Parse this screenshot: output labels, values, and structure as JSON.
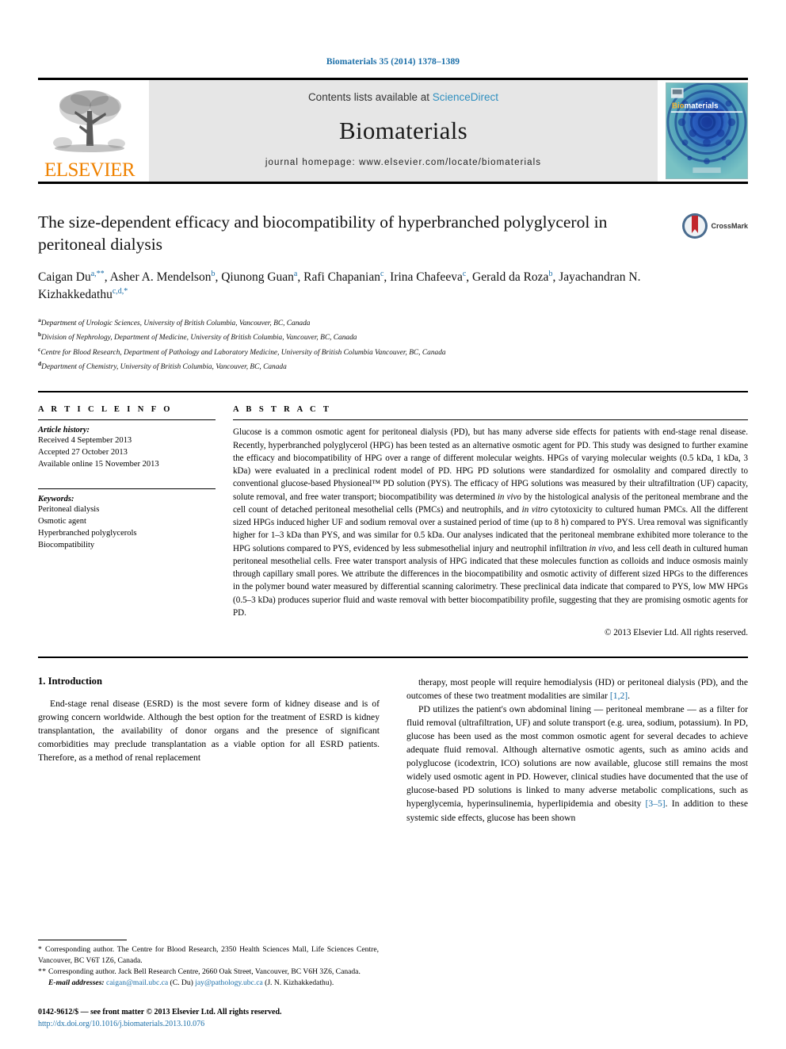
{
  "running_head": "Biomaterials 35 (2014) 1378–1389",
  "masthead": {
    "publisher": "ELSEVIER",
    "contents_prefix": "Contents lists available at ",
    "contents_link": "ScienceDirect",
    "journal_name": "Biomaterials",
    "homepage": "journal homepage: www.elsevier.com/locate/biomaterials",
    "cover_title_a": "Bio",
    "cover_title_b": "materials",
    "link_color": "#2f8fbf",
    "accent_color": "#1a6ea8",
    "elsevier_orange": "#ef8200"
  },
  "article": {
    "title": "The size-dependent efficacy and biocompatibility of hyperbranched polyglycerol in peritoneal dialysis",
    "crossmark_label": "CrossMark",
    "authors_line_1": "Caigan Du",
    "authors_line_2": "Gerald da Roza",
    "authors_html": "Caigan Du<sup>a,**</sup>, Asher A. Mendelson<sup>b</sup>, Qiunong Guan<sup>a</sup>, Rafi Chapanian<sup>c</sup>, Irina Chafeeva<sup>c</sup>, Gerald da Roza<sup>b</sup>, Jayachandran N. Kizhakkedathu<sup>c,d,*</sup>",
    "affiliations": [
      {
        "marker": "a",
        "text": "Department of Urologic Sciences, University of British Columbia, Vancouver, BC, Canada"
      },
      {
        "marker": "b",
        "text": "Division of Nephrology, Department of Medicine, University of British Columbia, Vancouver, BC, Canada"
      },
      {
        "marker": "c",
        "text": "Centre for Blood Research, Department of Pathology and Laboratory Medicine, University of British Columbia Vancouver, BC, Canada"
      },
      {
        "marker": "d",
        "text": "Department of Chemistry, University of British Columbia, Vancouver, BC, Canada"
      }
    ]
  },
  "article_info": {
    "heading": "A R T I C L E   I N F O",
    "history_label": "Article history:",
    "history": [
      "Received 4 September 2013",
      "Accepted 27 October 2013",
      "Available online 15 November 2013"
    ],
    "keywords_label": "Keywords:",
    "keywords": [
      "Peritoneal dialysis",
      "Osmotic agent",
      "Hyperbranched polyglycerols",
      "Biocompatibility"
    ]
  },
  "abstract": {
    "heading": "A B S T R A C T",
    "body_html": "Glucose is a common osmotic agent for peritoneal dialysis (PD), but has many adverse side effects for patients with end-stage renal disease. Recently, hyperbranched polyglycerol (HPG) has been tested as an alternative osmotic agent for PD. This study was designed to further examine the efficacy and biocompatibility of HPG over a range of different molecular weights. HPGs of varying molecular weights (0.5 kDa, 1 kDa, 3 kDa) were evaluated in a preclinical rodent model of PD. HPG PD solutions were standardized for osmolality and compared directly to conventional glucose-based Physioneal™ PD solution (PYS). The efficacy of HPG solutions was measured by their ultrafiltration (UF) capacity, solute removal, and free water transport; biocompatibility was determined <i>in vivo</i> by the histological analysis of the peritoneal membrane and the cell count of detached peritoneal mesothelial cells (PMCs) and neutrophils, and <i>in vitro</i> cytotoxicity to cultured human PMCs. All the different sized HPGs induced higher UF and sodium removal over a sustained period of time (up to 8 h) compared to PYS. Urea removal was significantly higher for 1–3 kDa than PYS, and was similar for 0.5 kDa. Our analyses indicated that the peritoneal membrane exhibited more tolerance to the HPG solutions compared to PYS, evidenced by less submesothelial injury and neutrophil infiltration <i>in vivo</i>, and less cell death in cultured human peritoneal mesothelial cells. Free water transport analysis of HPG indicated that these molecules function as colloids and induce osmosis mainly through capillary small pores. We attribute the differences in the biocompatibility and osmotic activity of different sized HPGs to the differences in the polymer bound water measured by differential scanning calorimetry. These preclinical data indicate that compared to PYS, low MW HPGs (0.5–3 kDa) produces superior fluid and waste removal with better biocompatibility profile, suggesting that they are promising osmotic agents for PD.",
    "copyright": "© 2013 Elsevier Ltd. All rights reserved."
  },
  "intro": {
    "section_number_title": "1.  Introduction",
    "left_para_html": "End-stage renal disease (ESRD) is the most severe form of kidney disease and is of growing concern worldwide. Although the best option for the treatment of ESRD is kidney transplantation, the availability of donor organs and the presence of significant comorbidities may preclude transplantation as a viable option for all ESRD patients. Therefore, as a method of renal replacement",
    "right_para_1_html": "therapy, most people will require hemodialysis (HD) or peritoneal dialysis (PD), and the outcomes of these two treatment modalities are similar <span class=\"cite\">[1,2]</span>.",
    "right_para_2_html": "PD utilizes the patient's own abdominal lining — peritoneal membrane — as a filter for fluid removal (ultrafiltration, UF) and solute transport (e.g. urea, sodium, potassium). In PD, glucose has been used as the most common osmotic agent for several decades to achieve adequate fluid removal. Although alternative osmotic agents, such as amino acids and polyglucose (icodextrin, ICO) solutions are now available, glucose still remains the most widely used osmotic agent in PD. However, clinical studies have documented that the use of glucose-based PD solutions is linked to many adverse metabolic complications, such as hyperglycemia, hyperinsulinemia, hyperlipidemia and obesity <span class=\"cite\">[3–5]</span>. In addition to these systemic side effects, glucose has been shown"
  },
  "footnotes": {
    "corresponding_1_html": "<span class=\"star\">*</span> Corresponding author. The Centre for Blood Research, 2350 Health Sciences Mall, Life Sciences Centre, Vancouver, BC V6T 1Z6, Canada.",
    "corresponding_2_html": "<span class=\"star\">**</span> Corresponding author. Jack Bell Research Centre, 2660 Oak Street, Vancouver, BC V6H 3Z6, Canada.",
    "email_label": "E-mail addresses:",
    "email_1": "caigan@mail.ubc.ca",
    "email_1_owner": "(C. Du)",
    "email_2": "jay@pathology.ubc.ca",
    "email_2_owner": "(J. N. Kizhakkedathu)."
  },
  "colophon": {
    "issn_line": "0142-9612/$ — see front matter © 2013 Elsevier Ltd. All rights reserved.",
    "doi": "http://dx.doi.org/10.1016/j.biomaterials.2013.10.076"
  }
}
